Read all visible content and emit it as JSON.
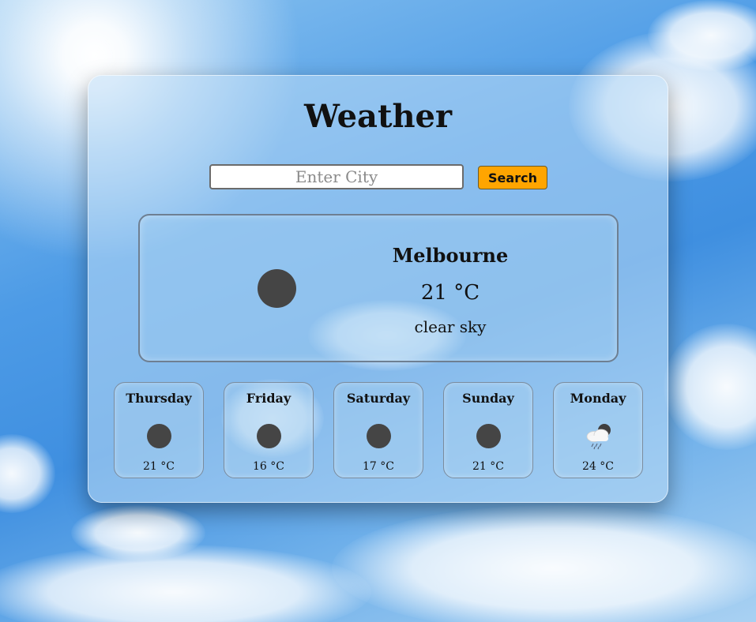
{
  "app": {
    "title": "Weather"
  },
  "search": {
    "placeholder": "Enter City",
    "value": "",
    "button_label": "Search",
    "button_color": "#ffa500"
  },
  "current": {
    "city": "Melbourne",
    "temperature": "21 °C",
    "description": "clear sky",
    "icon": "clear-sky-icon"
  },
  "forecast": [
    {
      "day": "Thursday",
      "temp": "21 °C",
      "icon": "clear-sky-icon"
    },
    {
      "day": "Friday",
      "temp": "16 °C",
      "icon": "clear-sky-icon"
    },
    {
      "day": "Saturday",
      "temp": "17 °C",
      "icon": "clear-sky-icon"
    },
    {
      "day": "Sunday",
      "temp": "21 °C",
      "icon": "clear-sky-icon"
    },
    {
      "day": "Monday",
      "temp": "24 °C",
      "icon": "rain-cloud-icon"
    }
  ]
}
